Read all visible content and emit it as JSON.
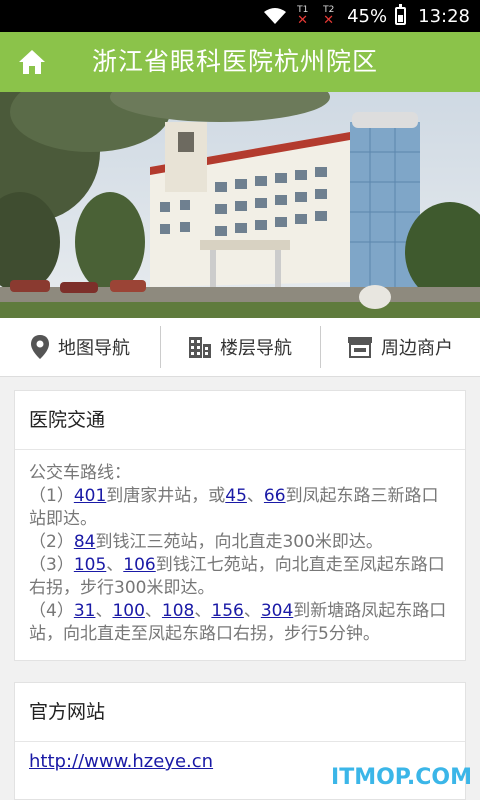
{
  "status_bar": {
    "battery": "45%",
    "time": "13:28",
    "sim1": "T1",
    "sim2": "T2",
    "sim_error": "✕"
  },
  "header": {
    "title": "浙江省眼科医院杭州院区",
    "home_icon": "home-icon"
  },
  "nav": [
    {
      "label": "地图导航",
      "icon": "location-pin-icon"
    },
    {
      "label": "楼层导航",
      "icon": "building-icon"
    },
    {
      "label": "周边商户",
      "icon": "shop-icon"
    }
  ],
  "transport": {
    "title": "医院交通",
    "intro": "公交车路线：",
    "route1": {
      "prefix": "（1）",
      "b1": "401",
      "t1": "到唐家井站，或",
      "b2": "45",
      "sep": "、",
      "b3": "66",
      "t2": "到凤起东路三新路口站即达。"
    },
    "route2": {
      "prefix": "（2）",
      "b1": "84",
      "t1": "到钱江三苑站，向北直走300米即达。"
    },
    "route3": {
      "prefix": "（3）",
      "b1": "105",
      "sep": "、",
      "b2": "106",
      "t1": "到钱江七苑站，向北直走至凤起东路口右拐，步行300米即达。"
    },
    "route4": {
      "prefix": "（4）",
      "b1": "31",
      "b2": "100",
      "b3": "108",
      "b4": "156",
      "b5": "304",
      "sep": "、",
      "t1": "到新塘路凤起东路口站，向北直走至凤起东路口右拐，步行5分钟。"
    }
  },
  "website": {
    "title": "官方网站",
    "url": "http://www.hzeye.cn"
  },
  "watermark": "ITMOP.COM",
  "colors": {
    "header_bg": "#8bc34a",
    "link": "#1a1aa6"
  }
}
